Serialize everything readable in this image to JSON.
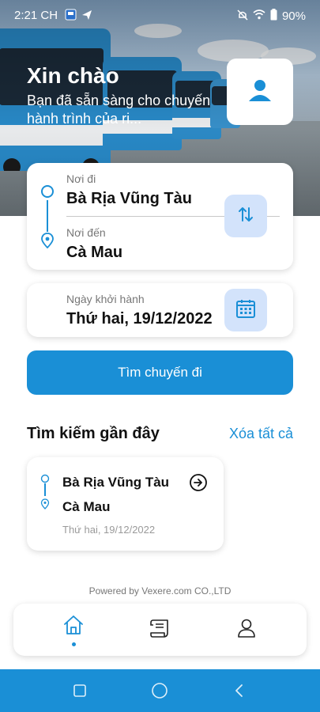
{
  "status_bar": {
    "time": "2:21 CH",
    "battery": "90%",
    "icons_left": [
      "app-notification-icon",
      "send-icon"
    ],
    "icons_right": [
      "mute-icon",
      "wifi-icon",
      "battery-icon"
    ]
  },
  "greeting": {
    "title": "Xin chào",
    "subtitle": "Bạn đã sẵn sàng cho chuyến hành trình của ri..."
  },
  "route": {
    "from_label": "Nơi đi",
    "from_value": "Bà Rịa Vũng Tàu",
    "to_label": "Nơi đến",
    "to_value": "Cà Mau"
  },
  "date": {
    "label": "Ngày khởi hành",
    "value": "Thứ hai, 19/12/2022"
  },
  "search_button": "Tìm chuyến đi",
  "recent": {
    "title": "Tìm kiếm gần đây",
    "clear_all": "Xóa tất cả",
    "items": [
      {
        "from": "Bà Rịa Vũng Tàu",
        "to": "Cà Mau",
        "date": "Thứ hai, 19/12/2022"
      }
    ]
  },
  "footer": {
    "powered_by": "Powered by Vexere.com CO.,LTD"
  },
  "bottom_nav": {
    "items": [
      "home-icon",
      "ticket-icon",
      "profile-icon"
    ],
    "active": "home-icon"
  },
  "colors": {
    "primary": "#1a8fd6",
    "button_bg": "#d3e3fb",
    "system_nav": "#1a8fd6"
  }
}
